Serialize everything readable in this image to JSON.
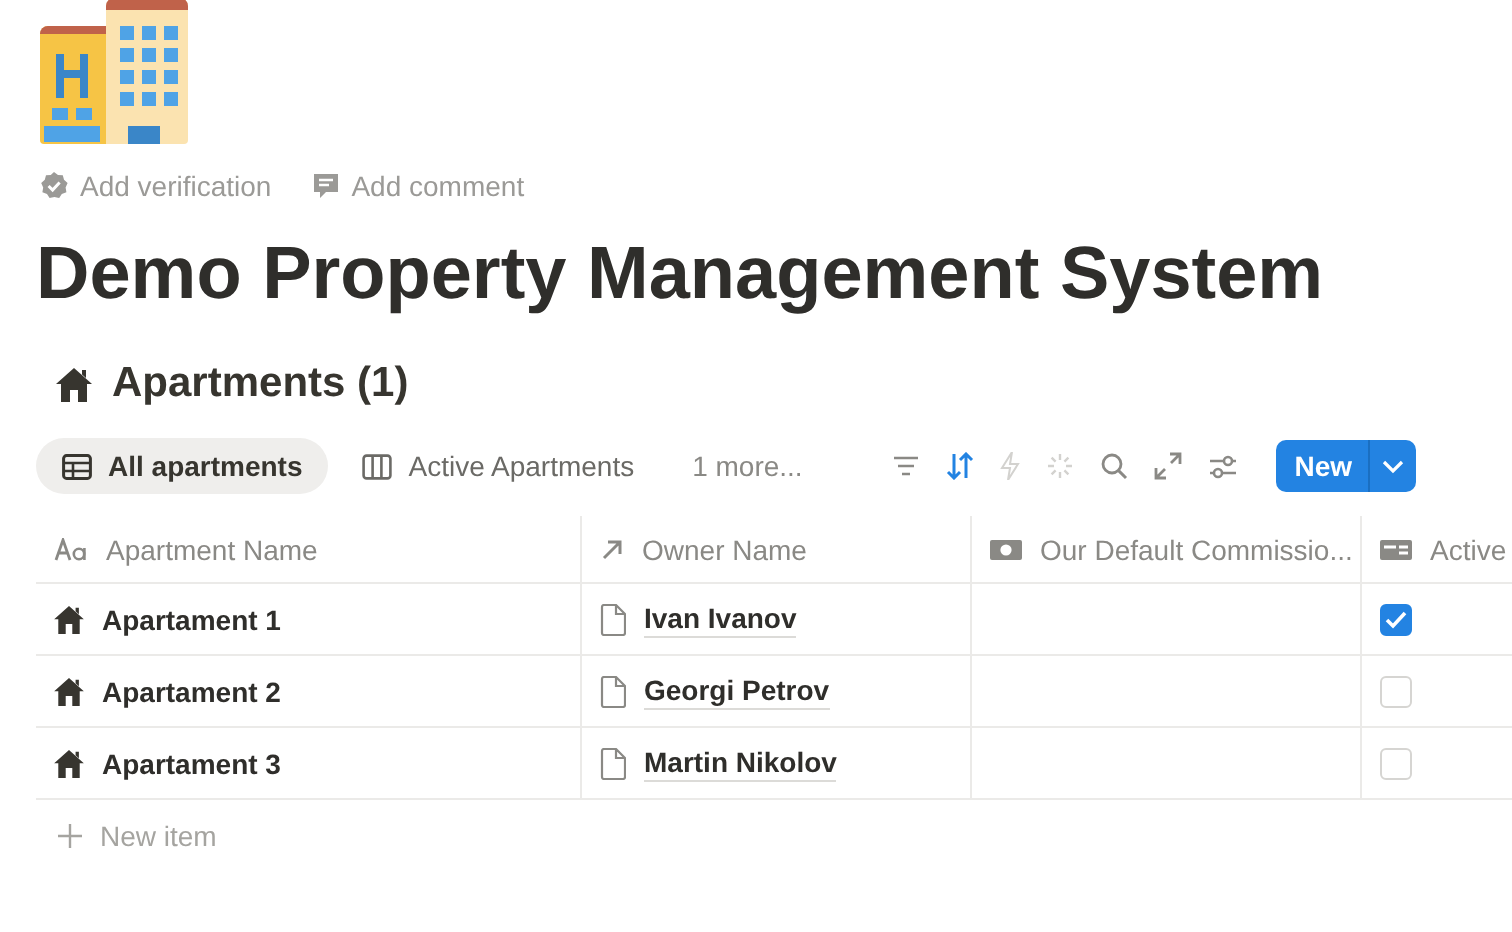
{
  "page": {
    "actions": [
      "Add verification",
      "Add comment"
    ],
    "title": "Demo Property Management System"
  },
  "database": {
    "title": "Apartments (1)",
    "views": [
      {
        "label": "All apartments",
        "kind": "table",
        "selected": true
      },
      {
        "label": "Active Apartments",
        "kind": "board",
        "selected": false
      }
    ],
    "more_views": "1 more...",
    "new_button": "New",
    "columns": [
      {
        "label": "Apartment Name",
        "kind": "title"
      },
      {
        "label": "Owner Name",
        "kind": "relation"
      },
      {
        "label": "Our Default Commissio...",
        "kind": "money"
      },
      {
        "label": "Active",
        "kind": "checkbox"
      }
    ],
    "rows": [
      {
        "name": "Apartament 1",
        "owner": "Ivan Ivanov",
        "active": true
      },
      {
        "name": "Apartament 2",
        "owner": "Georgi Petrov",
        "active": false
      },
      {
        "name": "Apartament 3",
        "owner": "Martin Nikolov",
        "active": false
      }
    ],
    "new_item": "New item"
  }
}
